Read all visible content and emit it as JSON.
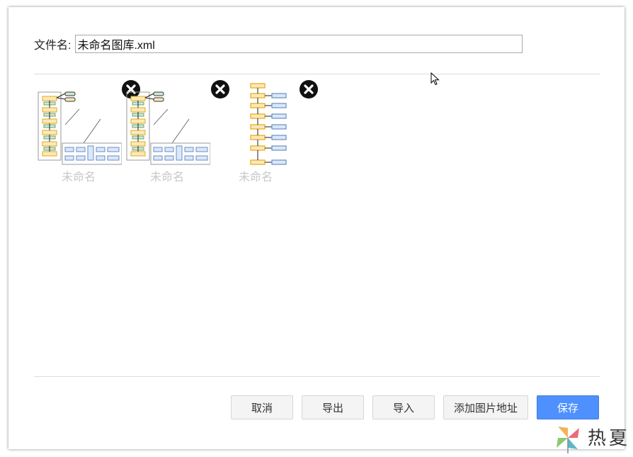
{
  "dialog": {
    "filename_label": "文件名:",
    "filename_value": "未命名图库.xml"
  },
  "library": {
    "items": [
      {
        "label": "未命名",
        "remove_icon": "close-circle-icon"
      },
      {
        "label": "未命名",
        "remove_icon": "close-circle-icon"
      },
      {
        "label": "未命名",
        "remove_icon": "close-circle-icon"
      }
    ]
  },
  "buttons": {
    "cancel": "取消",
    "export": "导出",
    "import": "导入",
    "add_image_url": "添加图片地址",
    "save": "保存"
  },
  "watermark": {
    "text": "热夏"
  },
  "colors": {
    "primary": "#4d90fe",
    "flow_orange": "#f5a623",
    "flow_blue": "#6c8ebf"
  }
}
